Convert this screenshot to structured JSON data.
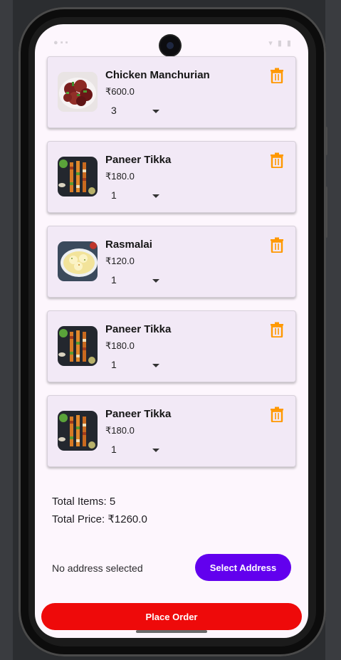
{
  "colors": {
    "primary": "#6200ee",
    "place_order": "#ee0a0a",
    "delete_icon": "#ff9800",
    "card_background": "#f2e9f6",
    "screen_background": "#fdf6fd"
  },
  "cart": {
    "items": [
      {
        "name": "Chicken Manchurian",
        "price": "₹600.0",
        "quantity": "3",
        "image": "chicken-manchurian-image",
        "icon": "delete-icon"
      },
      {
        "name": "Paneer Tikka",
        "price": "₹180.0",
        "quantity": "1",
        "image": "paneer-tikka-image",
        "icon": "delete-icon"
      },
      {
        "name": "Rasmalai",
        "price": "₹120.0",
        "quantity": "1",
        "image": "rasmalai-image",
        "icon": "delete-icon"
      },
      {
        "name": "Paneer Tikka",
        "price": "₹180.0",
        "quantity": "1",
        "image": "paneer-tikka-image",
        "icon": "delete-icon"
      },
      {
        "name": "Paneer Tikka",
        "price": "₹180.0",
        "quantity": "1",
        "image": "paneer-tikka-image",
        "icon": "delete-icon"
      }
    ]
  },
  "summary": {
    "total_items": "Total Items: 5",
    "total_price": "Total Price: ₹1260.0"
  },
  "address": {
    "status": "No address selected",
    "select_label": "Select Address"
  },
  "place_order_label": "Place Order"
}
